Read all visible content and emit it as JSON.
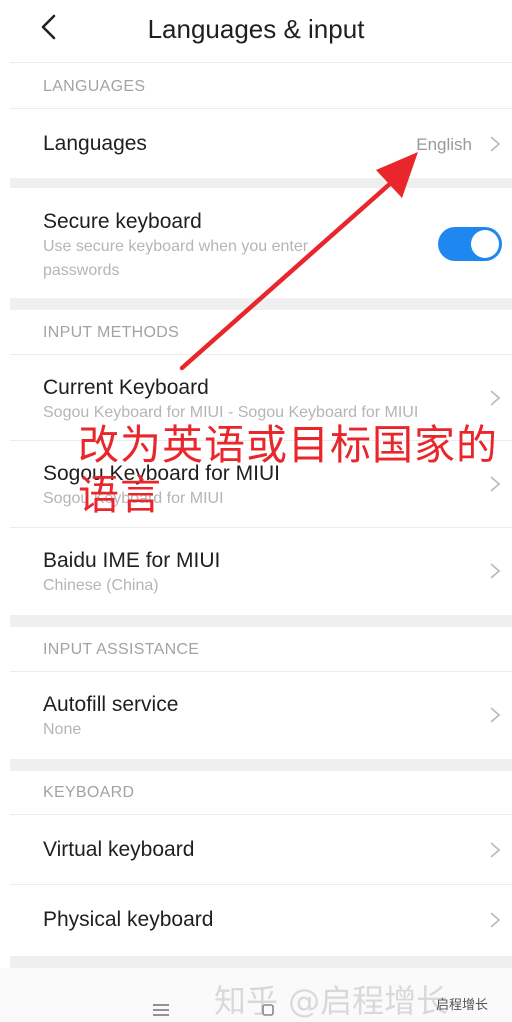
{
  "header": {
    "title": "Languages & input"
  },
  "sections": {
    "languages": "LANGUAGES",
    "input_methods": "INPUT METHODS",
    "input_assistance": "INPUT ASSISTANCE",
    "keyboard": "KEYBOARD"
  },
  "rows": {
    "languages": {
      "title": "Languages",
      "value": "English"
    },
    "secure_keyboard": {
      "title": "Secure keyboard",
      "subtitle_line1": "Use secure keyboard when you enter",
      "subtitle_line2": "passwords",
      "toggle_on": true
    },
    "current_keyboard": {
      "title": "Current Keyboard",
      "subtitle": "Sogou Keyboard for MIUI - Sogou Keyboard for MIUI"
    },
    "sogou": {
      "title": "Sogou Keyboard for MIUI",
      "subtitle": "Sogou Keyboard for MIUI"
    },
    "baidu": {
      "title": "Baidu IME for MIUI",
      "subtitle": "Chinese (China)"
    },
    "autofill": {
      "title": "Autofill service",
      "subtitle": "None"
    },
    "virtual_keyboard": {
      "title": "Virtual keyboard"
    },
    "physical_keyboard": {
      "title": "Physical keyboard"
    }
  },
  "annotation": {
    "text_line1": "改为英语或目标国家的",
    "text_line2": "语言",
    "color": "#e8262b"
  },
  "watermark": {
    "text": "知乎 @启程增长",
    "small": "启程增长"
  },
  "accent_color": "#1e88f0",
  "icons": [
    "back-icon",
    "chevron-right-icon",
    "toggle-switch",
    "menu-icon",
    "home-icon"
  ]
}
